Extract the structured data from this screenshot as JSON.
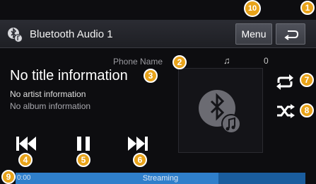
{
  "header": {
    "source_title": "Bluetooth Audio 1",
    "menu_label": "Menu"
  },
  "track": {
    "phone_name": "Phone Name",
    "count": "0",
    "title": "No title information",
    "artist": "No artist information",
    "album": "No album information"
  },
  "progress": {
    "time_start": "0:00",
    "label": "Streaming",
    "fraction": 0.7
  },
  "callouts": [
    "1",
    "2",
    "3",
    "4",
    "5",
    "6",
    "7",
    "8",
    "9",
    "10"
  ],
  "colors": {
    "accent": "#e8a31a",
    "progress": "#2f7fcb",
    "background": "#0d0d10"
  },
  "icons": {
    "source": "bluetooth-audio-icon",
    "back": "back-arrow-icon",
    "prev": "skip-previous-icon",
    "pause": "pause-icon",
    "next": "skip-next-icon",
    "repeat": "repeat-icon",
    "shuffle": "shuffle-icon",
    "album_art": "bluetooth-music-icon"
  }
}
